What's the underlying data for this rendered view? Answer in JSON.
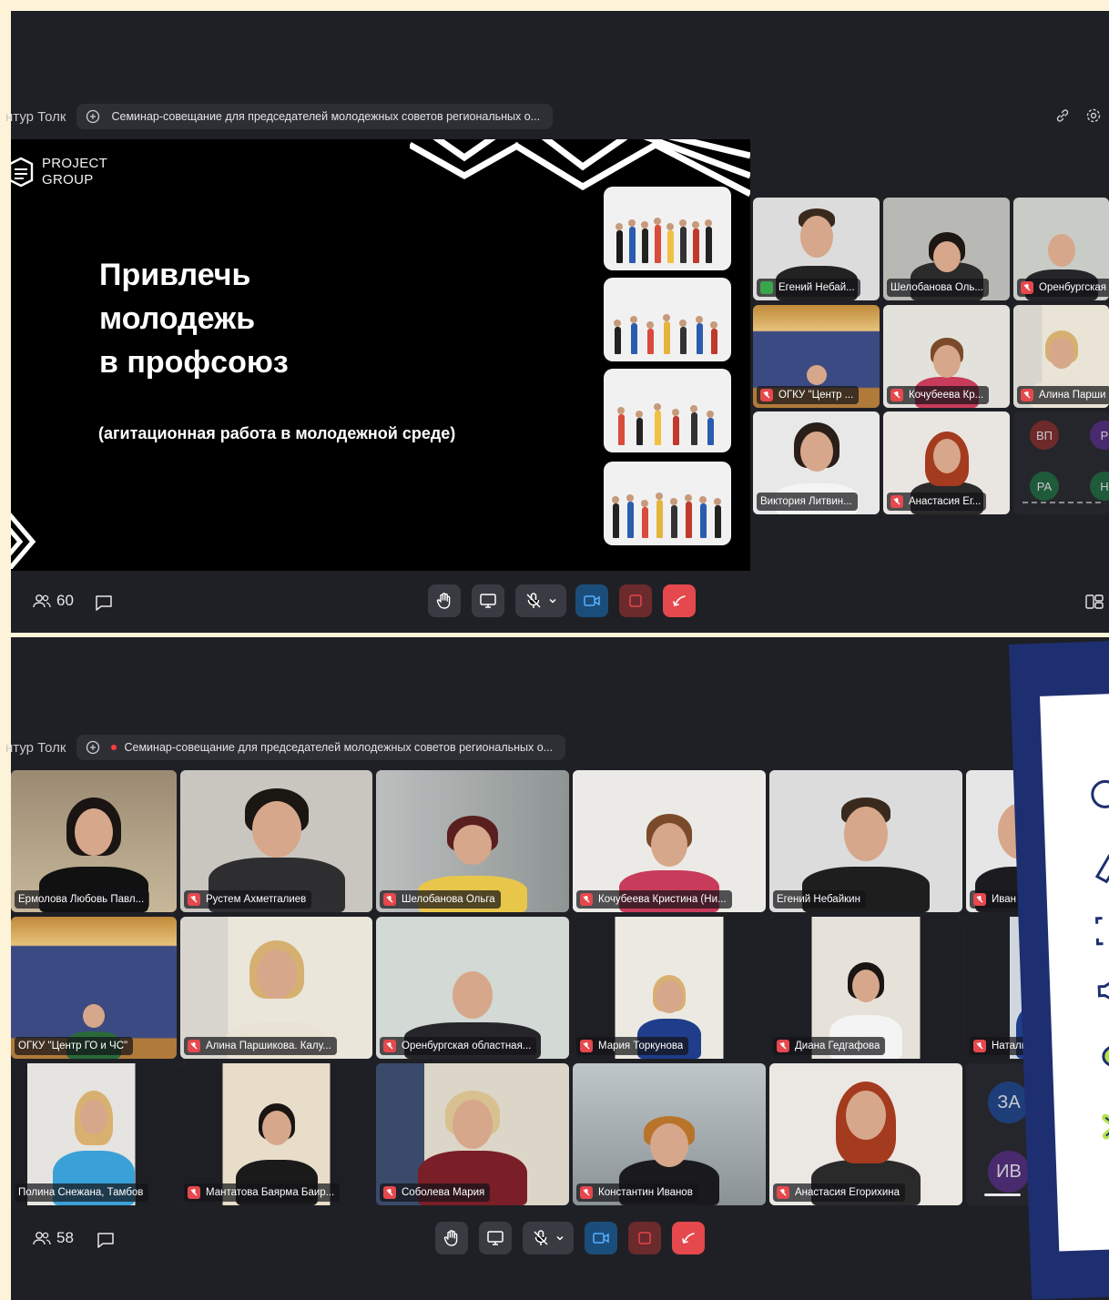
{
  "app": {
    "brand": "нтур Толк"
  },
  "meeting": {
    "title": "Семинар-совещание для председателей молодежных советов региональных о..."
  },
  "slide": {
    "logo_line1": "PROJECT",
    "logo_line2": "GROUP",
    "title_lines": [
      "Привлечь",
      "молодежь",
      "в профсоюз"
    ],
    "subtitle": "(агитационная работа в молодежной среде)"
  },
  "panel1": {
    "participants_count": "60",
    "tiles": [
      {
        "name": "Егений Небай...",
        "icon": "chat-icon"
      },
      {
        "name": "Шелобанова Оль...",
        "icon": "none"
      },
      {
        "name": "Оренбургская",
        "icon": "mic-off-icon"
      },
      {
        "name": "ОГКУ \"Центр ...",
        "icon": "mic-off-icon"
      },
      {
        "name": "Кочубеева Кр...",
        "icon": "mic-off-icon"
      },
      {
        "name": "Алина Парши",
        "icon": "mic-off-icon"
      },
      {
        "name": "Виктория Литвин...",
        "icon": "none"
      },
      {
        "name": "Анастасия Ег...",
        "icon": "mic-off-icon"
      }
    ],
    "grid_initials": [
      "ВП",
      "Р",
      "РА",
      "Н"
    ]
  },
  "panel2": {
    "participants_count": "58",
    "tiles": [
      {
        "name": "Ермолова Любовь Павл...",
        "icon": "none"
      },
      {
        "name": "Рустем Ахметгалиев",
        "icon": "mic-off-icon"
      },
      {
        "name": "Шелобанова Ольга",
        "icon": "mic-off-icon"
      },
      {
        "name": "Кочубеева Кристина (Ни...",
        "icon": "mic-off-icon"
      },
      {
        "name": "Егений Небайкин",
        "icon": "none"
      },
      {
        "name": "Иван Мощен",
        "icon": "mic-off-icon"
      },
      {
        "name": "ОГКУ \"Центр ГО и ЧС\"",
        "icon": "none"
      },
      {
        "name": "Алина Паршикова. Калу...",
        "icon": "mic-off-icon"
      },
      {
        "name": "Оренбургская областная...",
        "icon": "mic-off-icon"
      },
      {
        "name": "Мария Торкунова",
        "icon": "mic-off-icon"
      },
      {
        "name": "Диана Гедгафова",
        "icon": "mic-off-icon"
      },
      {
        "name": "Наталья",
        "icon": "mic-off-icon"
      },
      {
        "name": "Полина Снежана, Тамбов",
        "icon": "none"
      },
      {
        "name": "Мантатова Баярма Баир...",
        "icon": "mic-off-icon"
      },
      {
        "name": "Соболева Мария",
        "icon": "mic-off-icon"
      },
      {
        "name": "Константин Иванов",
        "icon": "mic-off-icon"
      },
      {
        "name": "Анастасия Егорихина",
        "icon": "mic-off-icon"
      }
    ],
    "grid_initials": [
      "ЗА",
      "ИВ"
    ]
  },
  "colors": {
    "panel_bg": "#1f2025",
    "accent_blue": "#2e8af0",
    "end_call": "#e5484d",
    "outer_bg": "#fdf3d9"
  }
}
